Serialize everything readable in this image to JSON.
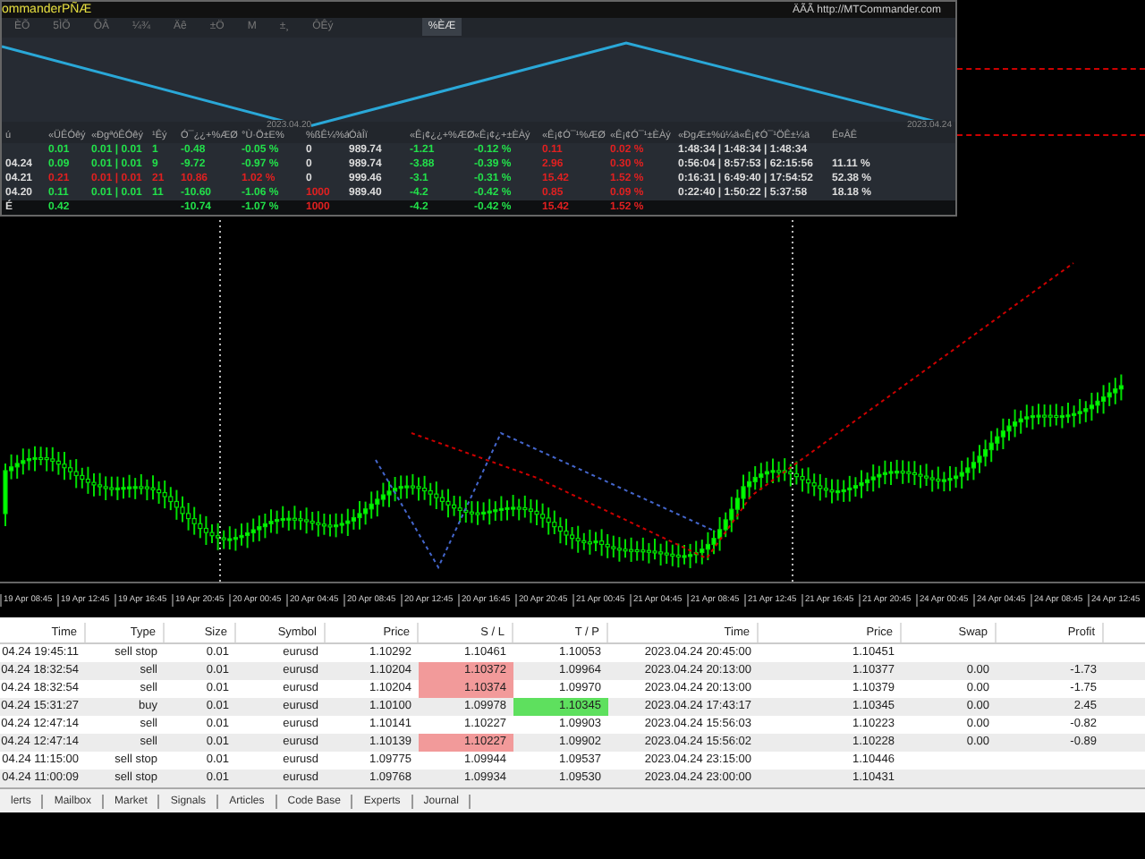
{
  "panel": {
    "title": "ommanderPÑÆ",
    "link": "ÄÃÃ http://MTCommander.com",
    "toolbar": [
      {
        "label": "ÈÕ",
        "selected": false
      },
      {
        "label": "5ÌÕ",
        "selected": false
      },
      {
        "label": "ÔÂ",
        "selected": false
      },
      {
        "label": "¼¾",
        "selected": false
      },
      {
        "label": "Äê",
        "selected": false
      },
      {
        "label": "±Ö",
        "selected": false
      },
      {
        "label": "M",
        "selected": false
      },
      {
        "label": "±¸",
        "selected": false
      },
      {
        "label": "ÔÊý",
        "selected": false
      },
      {
        "label": "%ÈÆ",
        "selected": true
      }
    ],
    "chart_dates": [
      "2023.04.20",
      "2023.04.24"
    ],
    "columns": [
      "ú",
      "«ÜÊÓêý",
      "«ÐgªóÊÓêý",
      "¹Êý",
      "Ó¯¿¿+%ÆØ",
      "°Ù·Ö±È%",
      "%ßÊ¼%á",
      "ÓàÎï",
      "«Ê¡¢¿¿+%ÆØ",
      "«Ê¡¢¿+±ÈÀý",
      "«Ê¡¢Ó¯¹%ÆØ",
      "«Ê¡¢Ó¯¹±ÈÀý",
      "«ÐgÆ±%ú¼ä«Ê¡¢Ó¯¹ÖÊ±¼ä",
      "Ê¤ÂÊ"
    ],
    "rows": [
      {
        "total": false,
        "cells": [
          null,
          {
            "text": "0.01",
            "color": "#22e04a"
          },
          {
            "text": "0.01 | 0.01",
            "color": "#22e04a"
          },
          {
            "text": "1",
            "color": "#22e04a"
          },
          {
            "text": "-0.48",
            "color": "#22e04a"
          },
          {
            "text": "-0.05 %",
            "color": "#22e04a"
          },
          {
            "text": "0",
            "color": "#dddddd"
          },
          {
            "text": "989.74",
            "color": "#dddddd"
          },
          {
            "text": "-1.21",
            "color": "#22e04a"
          },
          {
            "text": "-0.12 %",
            "color": "#22e04a"
          },
          {
            "text": "0.11",
            "color": "#e02020"
          },
          {
            "text": "0.02 %",
            "color": "#e02020"
          },
          {
            "text": "1:48:34 | 1:48:34 | 1:48:34",
            "color": "#dddddd"
          },
          null
        ]
      },
      {
        "total": false,
        "cells": [
          {
            "text": "04.24",
            "color": "#dddddd"
          },
          {
            "text": "0.09",
            "color": "#22e04a"
          },
          {
            "text": "0.01 | 0.01",
            "color": "#22e04a"
          },
          {
            "text": "9",
            "color": "#22e04a"
          },
          {
            "text": "-9.72",
            "color": "#22e04a"
          },
          {
            "text": "-0.97 %",
            "color": "#22e04a"
          },
          {
            "text": "0",
            "color": "#dddddd"
          },
          {
            "text": "989.74",
            "color": "#dddddd"
          },
          {
            "text": "-3.88",
            "color": "#22e04a"
          },
          {
            "text": "-0.39 %",
            "color": "#22e04a"
          },
          {
            "text": "2.96",
            "color": "#e02020"
          },
          {
            "text": "0.30 %",
            "color": "#e02020"
          },
          {
            "text": "0:56:04 | 8:57:53 | 62:15:56",
            "color": "#dddddd"
          },
          {
            "text": "11.11 %",
            "color": "#dddddd"
          }
        ]
      },
      {
        "total": false,
        "cells": [
          {
            "text": "04.21",
            "color": "#dddddd"
          },
          {
            "text": "0.21",
            "color": "#e02020"
          },
          {
            "text": "0.01 | 0.01",
            "color": "#e02020"
          },
          {
            "text": "21",
            "color": "#e02020"
          },
          {
            "text": "10.86",
            "color": "#e02020"
          },
          {
            "text": "1.02 %",
            "color": "#e02020"
          },
          {
            "text": "0",
            "color": "#dddddd"
          },
          {
            "text": "999.46",
            "color": "#dddddd"
          },
          {
            "text": "-3.1",
            "color": "#22e04a"
          },
          {
            "text": "-0.31 %",
            "color": "#22e04a"
          },
          {
            "text": "15.42",
            "color": "#e02020"
          },
          {
            "text": "1.52 %",
            "color": "#e02020"
          },
          {
            "text": "0:16:31 | 6:49:40 | 17:54:52",
            "color": "#dddddd"
          },
          {
            "text": "52.38 %",
            "color": "#dddddd"
          }
        ]
      },
      {
        "total": false,
        "cells": [
          {
            "text": "04.20",
            "color": "#dddddd"
          },
          {
            "text": "0.11",
            "color": "#22e04a"
          },
          {
            "text": "0.01 | 0.01",
            "color": "#22e04a"
          },
          {
            "text": "11",
            "color": "#22e04a"
          },
          {
            "text": "-10.60",
            "color": "#22e04a"
          },
          {
            "text": "-1.06 %",
            "color": "#22e04a"
          },
          {
            "text": "1000",
            "color": "#e02020"
          },
          {
            "text": "989.40",
            "color": "#dddddd"
          },
          {
            "text": "-4.2",
            "color": "#22e04a"
          },
          {
            "text": "-0.42 %",
            "color": "#22e04a"
          },
          {
            "text": "0.85",
            "color": "#e02020"
          },
          {
            "text": "0.09 %",
            "color": "#e02020"
          },
          {
            "text": "0:22:40 | 1:50:22 | 5:37:58",
            "color": "#dddddd"
          },
          {
            "text": "18.18 %",
            "color": "#dddddd"
          }
        ]
      },
      {
        "total": true,
        "cells": [
          {
            "text": "É",
            "color": "#dddddd"
          },
          {
            "text": "0.42",
            "color": "#22e04a"
          },
          null,
          null,
          {
            "text": "-10.74",
            "color": "#22e04a"
          },
          {
            "text": "-1.07 %",
            "color": "#22e04a"
          },
          {
            "text": "1000",
            "color": "#e02020"
          },
          null,
          {
            "text": "-4.2",
            "color": "#22e04a"
          },
          {
            "text": "-0.42 %",
            "color": "#22e04a"
          },
          {
            "text": "15.42",
            "color": "#e02020"
          },
          {
            "text": "1.52 %",
            "color": "#e02020"
          },
          null,
          null
        ]
      }
    ]
  },
  "time_axis": [
    "19 Apr 08:45",
    "19 Apr 12:45",
    "19 Apr 16:45",
    "19 Apr 20:45",
    "20 Apr 00:45",
    "20 Apr 04:45",
    "20 Apr 08:45",
    "20 Apr 12:45",
    "20 Apr 16:45",
    "20 Apr 20:45",
    "21 Apr 00:45",
    "21 Apr 04:45",
    "21 Apr 08:45",
    "21 Apr 12:45",
    "21 Apr 16:45",
    "21 Apr 20:45",
    "24 Apr 00:45",
    "24 Apr 04:45",
    "24 Apr 08:45",
    "24 Apr 12:45"
  ],
  "orders": {
    "columns": [
      "Time",
      "Type",
      "Size",
      "Symbol",
      "Price",
      "S / L",
      "T / P",
      "Time",
      "Price",
      "Swap",
      "Profit"
    ],
    "rows": [
      {
        "time": "04.24 19:45:11",
        "type": "sell stop",
        "size": "0.01",
        "symbol": "eurusd",
        "price": "1.10292",
        "sl": "1.10461",
        "sl_alert": false,
        "tp": "1.10053",
        "tp_alert": false,
        "close_time": "2023.04.24 20:45:00",
        "close_price": "1.10451"
      },
      {
        "time": "04.24 18:32:54",
        "type": "sell",
        "size": "0.01",
        "symbol": "eurusd",
        "price": "1.10204",
        "sl": "1.10372",
        "sl_alert": true,
        "tp": "1.09964",
        "tp_alert": false,
        "close_time": "2023.04.24 20:13:00",
        "close_price": "1.10377",
        "swap": "0.00",
        "profit": "-1.73"
      },
      {
        "time": "04.24 18:32:54",
        "type": "sell",
        "size": "0.01",
        "symbol": "eurusd",
        "price": "1.10204",
        "sl": "1.10374",
        "sl_alert": true,
        "tp": "1.09970",
        "tp_alert": false,
        "close_time": "2023.04.24 20:13:00",
        "close_price": "1.10379",
        "swap": "0.00",
        "profit": "-1.75"
      },
      {
        "time": "04.24 15:31:27",
        "type": "buy",
        "size": "0.01",
        "symbol": "eurusd",
        "price": "1.10100",
        "sl": "1.09978",
        "sl_alert": false,
        "tp": "1.10345",
        "tp_alert": true,
        "close_time": "2023.04.24 17:43:17",
        "close_price": "1.10345",
        "swap": "0.00",
        "profit": "2.45"
      },
      {
        "time": "04.24 12:47:14",
        "type": "sell",
        "size": "0.01",
        "symbol": "eurusd",
        "price": "1.10141",
        "sl": "1.10227",
        "sl_alert": false,
        "tp": "1.09903",
        "tp_alert": false,
        "close_time": "2023.04.24 15:56:03",
        "close_price": "1.10223",
        "swap": "0.00",
        "profit": "-0.82"
      },
      {
        "time": "04.24 12:47:14",
        "type": "sell",
        "size": "0.01",
        "symbol": "eurusd",
        "price": "1.10139",
        "sl": "1.10227",
        "sl_alert": true,
        "tp": "1.09902",
        "tp_alert": false,
        "close_time": "2023.04.24 15:56:02",
        "close_price": "1.10228",
        "swap": "0.00",
        "profit": "-0.89"
      },
      {
        "time": "04.24 11:15:00",
        "type": "sell stop",
        "size": "0.01",
        "symbol": "eurusd",
        "price": "1.09775",
        "sl": "1.09944",
        "sl_alert": false,
        "tp": "1.09537",
        "tp_alert": false,
        "close_time": "2023.04.24 23:15:00",
        "close_price": "1.10446"
      },
      {
        "time": "04.24 11:00:09",
        "type": "sell stop",
        "size": "0.01",
        "symbol": "eurusd",
        "price": "1.09768",
        "sl": "1.09934",
        "sl_alert": false,
        "tp": "1.09530",
        "tp_alert": false,
        "close_time": "2023.04.24 23:00:00",
        "close_price": "1.10431"
      }
    ]
  },
  "tabs": [
    "lerts",
    "Mailbox",
    "Market",
    "Signals",
    "Articles",
    "Code Base",
    "Experts",
    "Journal"
  ]
}
